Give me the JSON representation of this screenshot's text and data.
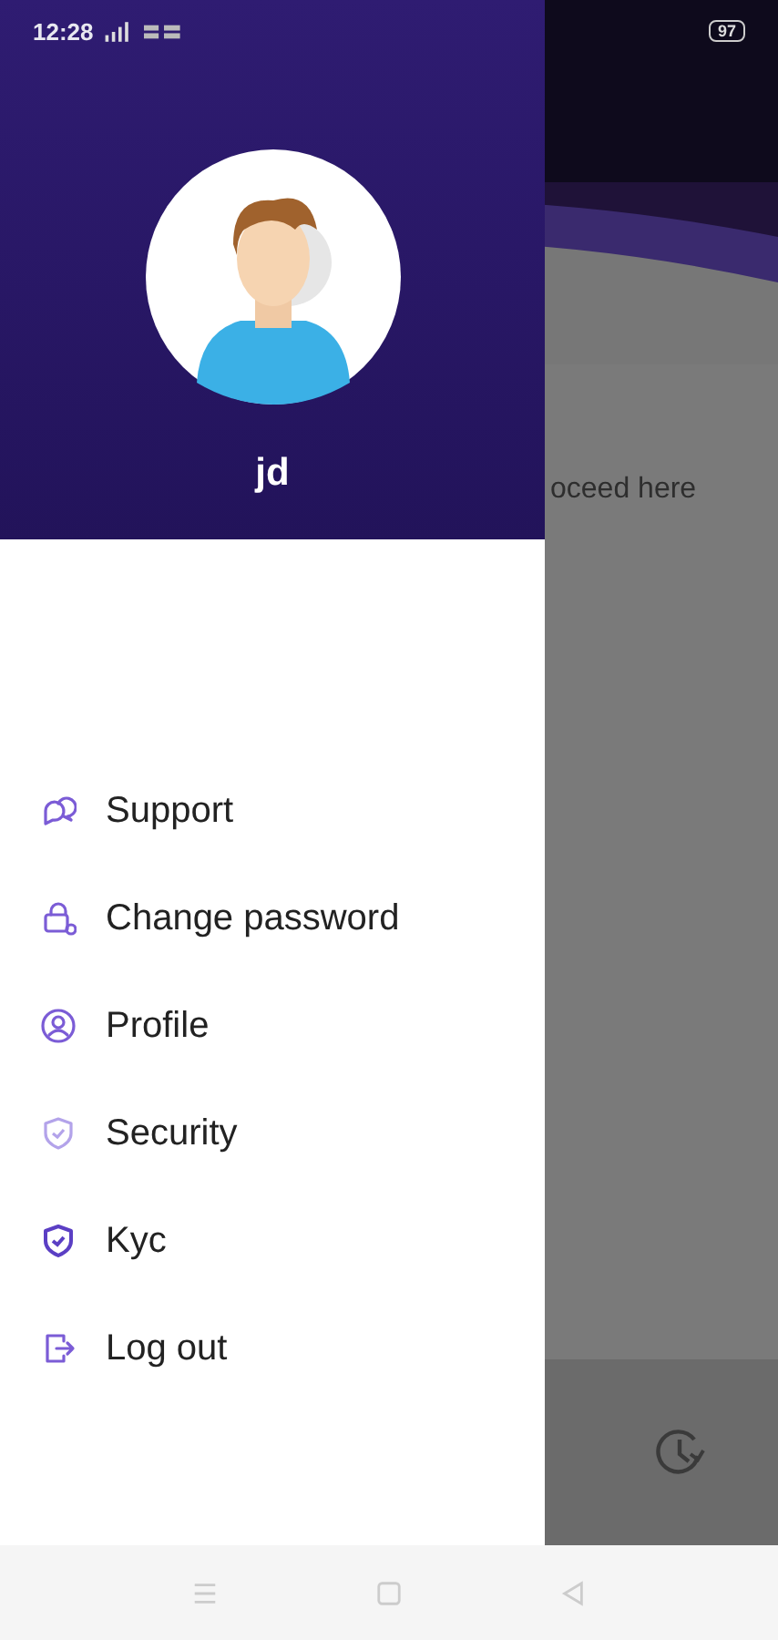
{
  "status_bar": {
    "time": "12:28",
    "battery": "97"
  },
  "background_app": {
    "text": "oceed here"
  },
  "drawer": {
    "user_name": "jd",
    "menu": [
      {
        "label": "Support",
        "kind": "support"
      },
      {
        "label": "Change password",
        "kind": "password"
      },
      {
        "label": "Profile",
        "kind": "profile"
      },
      {
        "label": "Security",
        "kind": "security"
      },
      {
        "label": "Kyc",
        "kind": "kyc"
      },
      {
        "label": "Log out",
        "kind": "logout"
      }
    ]
  }
}
